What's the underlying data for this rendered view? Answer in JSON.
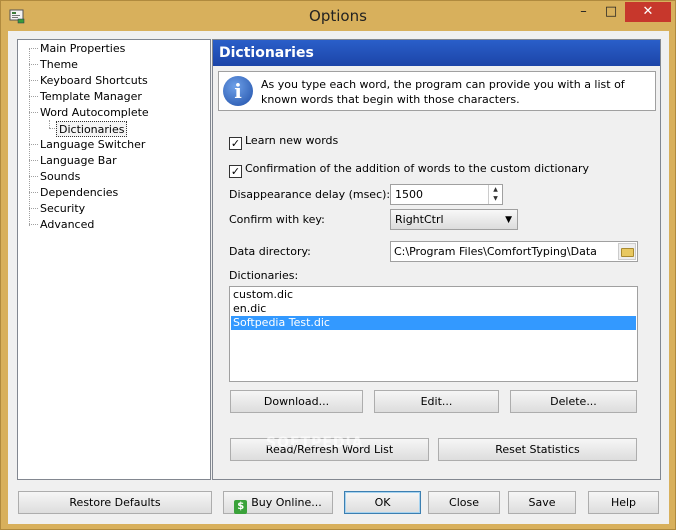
{
  "window": {
    "title": "Options",
    "minimize_glyph": "–",
    "maximize_glyph": "□",
    "close_glyph": "✕"
  },
  "tree": {
    "items": [
      {
        "label": "Main Properties",
        "level": 0
      },
      {
        "label": "Theme",
        "level": 0
      },
      {
        "label": "Keyboard Shortcuts",
        "level": 0
      },
      {
        "label": "Template Manager",
        "level": 0
      },
      {
        "label": "Word Autocomplete",
        "level": 0
      },
      {
        "label": "Dictionaries",
        "level": 1,
        "selected": true
      },
      {
        "label": "Language Switcher",
        "level": 0
      },
      {
        "label": "Language Bar",
        "level": 0
      },
      {
        "label": "Sounds",
        "level": 0
      },
      {
        "label": "Dependencies",
        "level": 0
      },
      {
        "label": "Security",
        "level": 0
      },
      {
        "label": "Advanced",
        "level": 0
      }
    ]
  },
  "panel": {
    "title": "Dictionaries",
    "info_glyph": "i",
    "info_text": "As you type each word, the program can provide you with a list of known words that begin with those characters.",
    "learn_new_words": {
      "label": "Learn new words",
      "checked": true,
      "check_glyph": "✓"
    },
    "confirm_addition": {
      "label": "Confirmation of the addition of words to the custom dictionary",
      "checked": true,
      "check_glyph": "✓"
    },
    "disappearance_delay": {
      "label": "Disappearance delay (msec):",
      "value": "1500"
    },
    "confirm_key": {
      "label": "Confirm with key:",
      "value": "RightCtrl"
    },
    "data_directory": {
      "label": "Data directory:",
      "value": "C:\\Program Files\\ComfortTyping\\Data"
    },
    "dictionaries_label": "Dictionaries:",
    "dictionaries": [
      {
        "name": "custom.dic",
        "selected": false
      },
      {
        "name": "en.dic",
        "selected": false
      },
      {
        "name": "Softpedia Test.dic",
        "selected": true
      }
    ],
    "buttons": {
      "download": "Download...",
      "edit": "Edit...",
      "delete": "Delete...",
      "read_refresh": "Read/Refresh Word List",
      "reset_statistics": "Reset Statistics"
    }
  },
  "footer": {
    "restore_defaults": "Restore Defaults",
    "buy_online": "Buy Online...",
    "buy_icon_glyph": "$",
    "ok": "OK",
    "close": "Close",
    "save": "Save",
    "help": "Help"
  },
  "watermark": "SOFTPEDIA",
  "colors": {
    "frame": "#d8b05c",
    "header": "#1c45a8",
    "selection": "#3399ff",
    "close_button": "#c7372c"
  }
}
